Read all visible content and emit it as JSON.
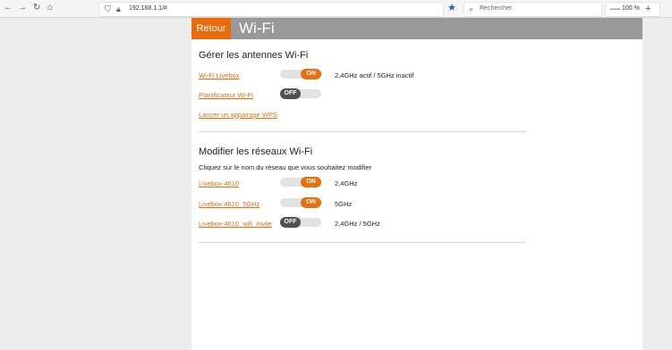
{
  "browser": {
    "url": "192.168.1.1/#",
    "search_placeholder": "Rechercher",
    "zoom": "100 %"
  },
  "page": {
    "back_label": "Retour",
    "title": "Wi-Fi"
  },
  "antennas": {
    "heading": "Gérer les antennes Wi-Fi",
    "livebox_link": "Wi-Fi Livebox",
    "livebox_toggle": "ON",
    "livebox_status": "2,4GHz actif / 5GHz inactif",
    "scheduler_link": "Planificateur Wi-Fi",
    "scheduler_toggle": "OFF",
    "wps_link": "Lancer un appairage WPS"
  },
  "networks": {
    "heading": "Modifier les réseaux Wi-Fi",
    "instruction": "Cliquez sur le nom du réseau que vous souhaitez modifier",
    "items": [
      {
        "name": "Livebox-4610",
        "toggle": "ON",
        "band": "2,4GHz"
      },
      {
        "name": "Livebox-4610_5GHz",
        "toggle": "ON",
        "band": "5GHz"
      },
      {
        "name": "Livebox-4610_wifi_invite",
        "toggle": "OFF",
        "band": "2,4GHz / 5GHz"
      }
    ]
  }
}
